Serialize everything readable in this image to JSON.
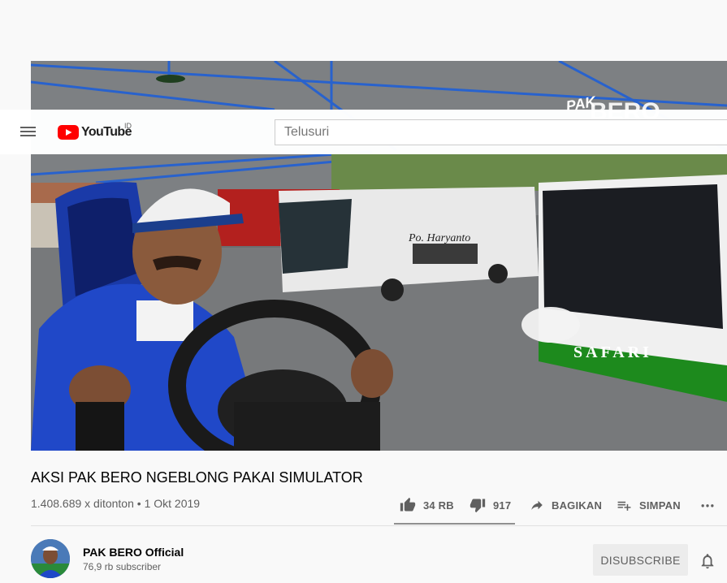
{
  "masthead": {
    "logo_text": "YouTube",
    "logo_region": "ID",
    "search_placeholder": "Telusuri"
  },
  "video": {
    "watermark_small": "PAK",
    "watermark_big": "BERO",
    "bus1_brand": "Po. Haryanto",
    "bus2_brand": "SAFARI",
    "title": "AKSI PAK BERO NGEBLONG PAKAI SIMULATOR",
    "views": "1.408.689 x ditonton",
    "date": "1 Okt 2019",
    "meta_separator": "•"
  },
  "actions": {
    "likes": "34 RB",
    "dislikes": "917",
    "share": "BAGIKAN",
    "save": "SIMPAN",
    "likes_share": 0.974
  },
  "channel": {
    "name": "PAK BERO Official",
    "subscribers": "76,9 rb subscriber",
    "subscribe": "DISUBSCRIBE"
  },
  "icons": {
    "menu": "menu-icon",
    "logo": "youtube-logo-icon",
    "like": "thumb-up-icon",
    "dislike": "thumb-down-icon",
    "share": "share-arrow-icon",
    "save": "playlist-add-icon",
    "more": "more-horizontal-icon",
    "bell": "bell-icon"
  },
  "colors": {
    "brand_red": "#ff0000",
    "page_background": "#f9f9f9",
    "text_primary": "#030303",
    "text_secondary": "#606060"
  }
}
